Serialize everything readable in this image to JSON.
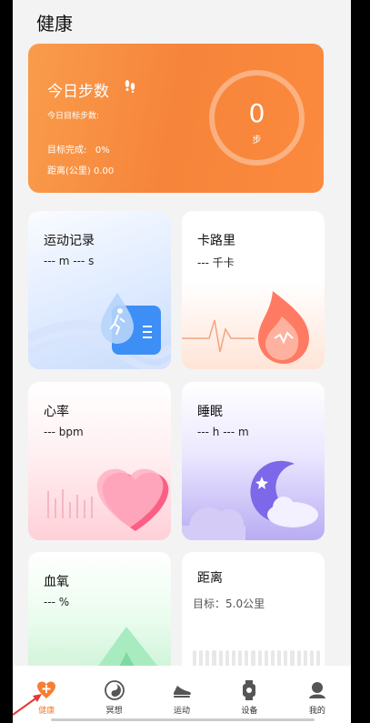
{
  "header": {
    "title": "健康"
  },
  "steps": {
    "title": "今日步数",
    "goal_label": "今日目标步数:",
    "complete_label": "目标完成:",
    "complete_value": "0%",
    "distance_label": "距离(公里)",
    "distance_value": "0.00",
    "count": "0",
    "unit": "步",
    "ring_progress": 0,
    "icon": "footprints-icon"
  },
  "cards": {
    "sport": {
      "title": "运动记录",
      "value": "--- m --- s"
    },
    "calorie": {
      "title": "卡路里",
      "value": "--- 千卡"
    },
    "heart": {
      "title": "心率",
      "value": "--- bpm"
    },
    "sleep": {
      "title": "睡眠",
      "value": "--- h --- m"
    },
    "oxygen": {
      "title": "血氧",
      "value": "--- %"
    },
    "distance": {
      "title": "距离",
      "goal": "目标：5.0公里"
    }
  },
  "tabbar": {
    "items": [
      {
        "label": "健康",
        "icon": "health-icon",
        "active": true
      },
      {
        "label": "冥想",
        "icon": "meditation-icon",
        "active": false
      },
      {
        "label": "运动",
        "icon": "shoe-icon",
        "active": false
      },
      {
        "label": "设备",
        "icon": "watch-icon",
        "active": false
      },
      {
        "label": "我的",
        "icon": "profile-icon",
        "active": false
      }
    ]
  },
  "colors": {
    "accent": "#f57f33",
    "steps_card": "#f7883d"
  }
}
